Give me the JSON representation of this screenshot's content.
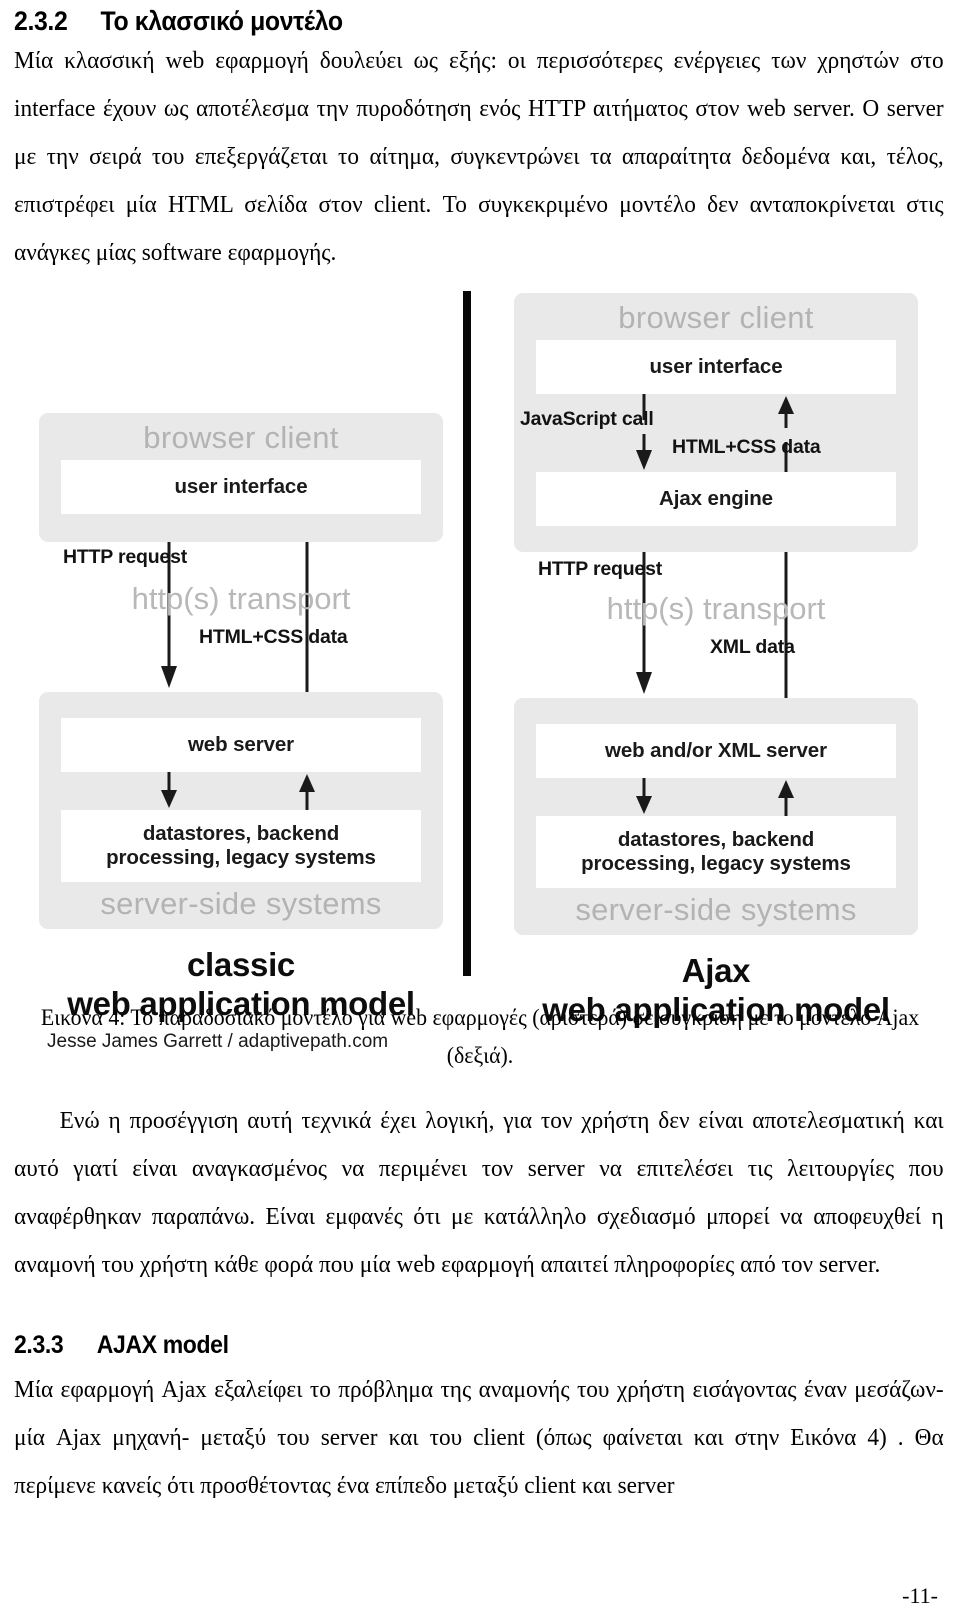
{
  "document": {
    "page_number": "-11-"
  },
  "sections": [
    {
      "number": "2.3.2",
      "title": "Το κλασσικό μοντέλο",
      "paragraphs": [
        "Μία κλασσική web εφαρμογή δουλεύει ως εξής: οι περισσότερες ενέργειες των χρηστών στο interface έχουν ως αποτέλεσμα την πυροδότηση ενός HTTP αιτήματος στον web server. Ο server με την σειρά του επεξεργάζεται το αίτημα, συγκεντρώνει τα απαραίτητα δεδομένα και, τέλος, επιστρέφει μία HTML σελίδα στον client. Το συγκεκριμένο μοντέλο δεν ανταποκρίνεται στις ανάγκες μίας software εφαρμογής."
      ]
    }
  ],
  "figure": {
    "caption": "Εικόνα 4: Το παραδοσιακό μοντέλο για web εφαρμογές (αριστερά) σε σύγκριση με το μοντέλο Ajax (δεξιά).",
    "attribution": "Jesse James Garrett / adaptivepath.com",
    "colors": {
      "group_fill": "#e9e9e9",
      "group_title": "#b3b3b3",
      "box_fill": "#ffffff",
      "divider": "#080808"
    },
    "classic_model": {
      "title": "classic\nweb application model",
      "title_line1": "classic",
      "title_line2": "web application model",
      "browser_group_label": "browser client",
      "browser_boxes": [
        "user interface"
      ],
      "transport_label": "http(s) transport",
      "flow_down_label": "HTTP request",
      "flow_up_label": "HTML+CSS data",
      "server_group_label": "server-side systems",
      "server_boxes": [
        "web server",
        "datastores, backend\nprocessing, legacy systems"
      ],
      "server_box_1": "web server",
      "server_box_2_line1": "datastores, backend",
      "server_box_2_line2": "processing, legacy systems"
    },
    "ajax_model": {
      "title_line1": "Ajax",
      "title_line2": "web application model",
      "browser_group_label": "browser client",
      "browser_box_1": "user interface",
      "browser_box_2": "Ajax engine",
      "inner_flow_down_label": "JavaScript call",
      "inner_flow_up_label": "HTML+CSS data",
      "transport_label": "http(s) transport",
      "flow_down_label": "HTTP request",
      "flow_up_label": "XML data",
      "server_group_label": "server-side systems",
      "server_box_1": "web and/or XML server",
      "server_box_2_line1": "datastores, backend",
      "server_box_2_line2": "processing, legacy systems"
    }
  },
  "after_figure": {
    "paragraph_1": "Ενώ η προσέγγιση αυτή τεχνικά έχει λογική, για τον χρήστη δεν είναι αποτελεσματική και αυτό γιατί είναι αναγκασμένος να περιμένει τον server να επιτελέσει τις λειτουργίες που αναφέρθηκαν παραπάνω. Είναι εμφανές ότι με κατάλληλο σχεδιασμό μπορεί να αποφευχθεί η αναμονή του χρήστη κάθε φορά που μία web εφαρμογή απαιτεί πληροφορίες από τον server."
  },
  "section_ajax": {
    "number": "2.3.3",
    "title": "AJAX model",
    "paragraph_1": "Μία εφαρμογή Ajax εξαλείφει το πρόβλημα της αναμονής του χρήστη εισάγοντας έναν μεσάζων- μία Ajax μηχανή- μεταξύ του server και του client (όπως φαίνεται και στην Εικόνα 4) . Θα περίμενε κανείς ότι προσθέτοντας ένα επίπεδο μεταξύ client και server"
  }
}
